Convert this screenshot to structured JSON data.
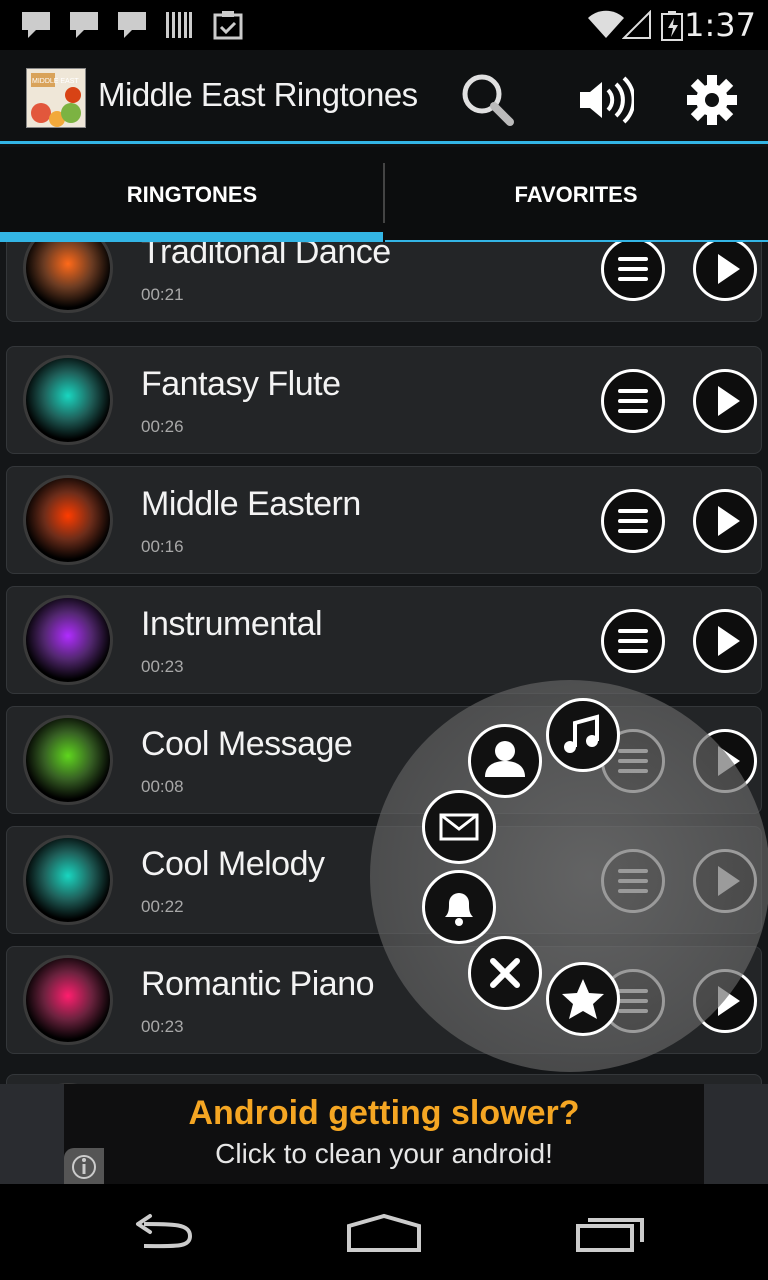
{
  "status_bar": {
    "time": "1:37",
    "icons": [
      "message-icon",
      "message-icon",
      "message-icon",
      "barcode-icon",
      "clipboard-check-icon",
      "wifi-icon",
      "signal-icon",
      "battery-charging-icon"
    ]
  },
  "action_bar": {
    "title": "Middle East Ringtones",
    "logo_text": "MIDDLE EAST",
    "icons": [
      "search-icon",
      "volume-icon",
      "settings-gear-icon"
    ]
  },
  "tabs": [
    {
      "label": "RINGTONES",
      "active": true
    },
    {
      "label": "FAVORITES",
      "active": false
    }
  ],
  "ringtones": [
    {
      "title": "Traditonal Dance",
      "duration": "00:21",
      "color": "#ff6a1a"
    },
    {
      "title": "Fantasy Flute",
      "duration": "00:26",
      "color": "#19d6c0"
    },
    {
      "title": "Middle Eastern",
      "duration": "00:16",
      "color": "#ff3c00"
    },
    {
      "title": "Instrumental",
      "duration": "00:23",
      "color": "#b02cff"
    },
    {
      "title": "Cool Message",
      "duration": "00:08",
      "color": "#5fd61e"
    },
    {
      "title": "Cool Melody",
      "duration": "00:22",
      "color": "#19d6c0"
    },
    {
      "title": "Romantic Piano",
      "duration": "00:23",
      "color": "#ff1e6e"
    }
  ],
  "radial_menu": [
    "music-note-icon",
    "contact-icon",
    "mail-icon",
    "bell-icon",
    "close-icon",
    "star-icon"
  ],
  "ad": {
    "headline": "Android getting slower?",
    "subline": "Click to clean your android!"
  },
  "nav_bar": [
    "back-icon",
    "home-icon",
    "recent-apps-icon"
  ],
  "colors": {
    "accent": "#33b5e5",
    "ad_headline": "#f5a623"
  }
}
